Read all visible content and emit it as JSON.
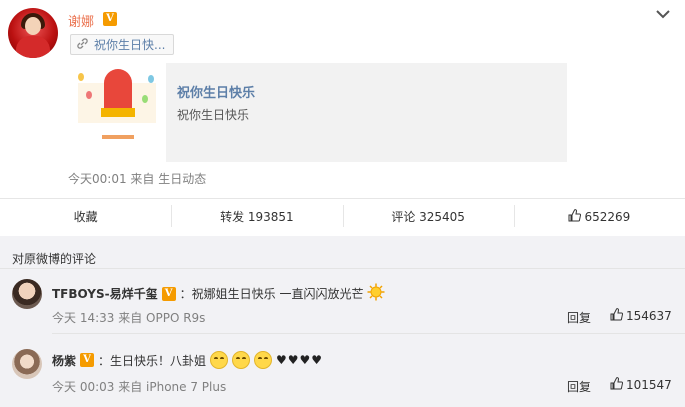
{
  "post": {
    "username": "谢娜",
    "verified_icon": "V",
    "link_chip": "祝你生日快...",
    "card": {
      "title": "祝你生日快乐",
      "description": "祝你生日快乐"
    },
    "meta": "今天00:01 来自 生日动态"
  },
  "actions": {
    "favorite": "收藏",
    "repost": "转发 193851",
    "comment": "评论 325405",
    "like": "652269"
  },
  "comments_section": {
    "title": "对原微博的评论",
    "items": [
      {
        "name": "TFBOYS-易烊千玺",
        "verified_icon": "V",
        "text": "：祝娜姐生日快乐 一直闪闪放光芒",
        "emoji": "sun-emoji",
        "time": "今天 14:33 来自 OPPO R9s",
        "reply": "回复",
        "likes": "154637"
      },
      {
        "name": "杨紫",
        "verified_icon": "V",
        "text": "：生日快乐！八卦姐",
        "emoji": "giggle-emoji",
        "hearts": "♥♥♥♥",
        "time": "今天 00:03 来自 iPhone 7 Plus",
        "reply": "回复",
        "likes": "101547"
      }
    ]
  },
  "colors": {
    "accent": "#eb7350",
    "link": "#5d7fa8",
    "badge": "#f59b00"
  }
}
